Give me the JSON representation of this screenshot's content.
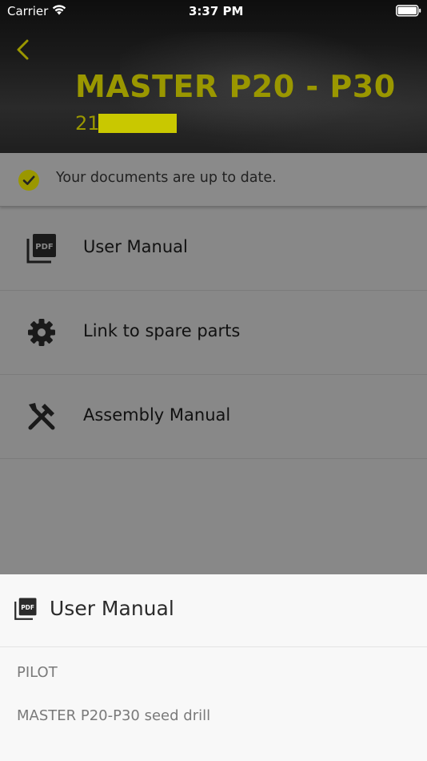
{
  "status_bar": {
    "carrier": "Carrier",
    "time": "3:37 PM"
  },
  "header": {
    "title": "MASTER P20 - P30",
    "serial_prefix": "21",
    "accent_color": "#9a9700",
    "redaction_color": "#c9c800"
  },
  "notice": {
    "text": "Your documents are up to date.",
    "icon": "check-circle-icon"
  },
  "documents": [
    {
      "label": "User Manual",
      "icon": "pdf-icon"
    },
    {
      "label": "Link to spare parts",
      "icon": "gear-icon"
    },
    {
      "label": "Assembly Manual",
      "icon": "tools-icon"
    }
  ],
  "sheet": {
    "title": "User Manual",
    "icon": "pdf-icon",
    "options": [
      "PILOT",
      "MASTER P20-P30 seed drill"
    ]
  }
}
